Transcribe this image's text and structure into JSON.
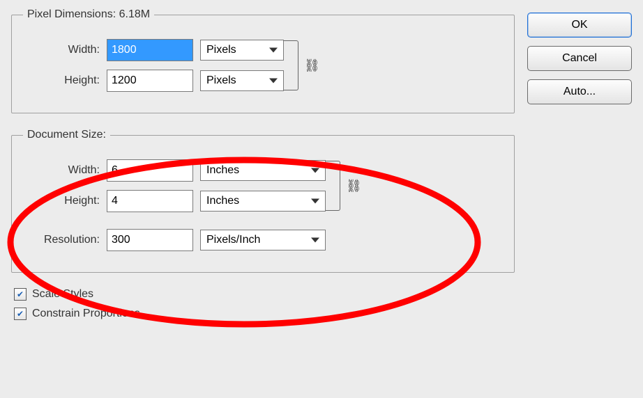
{
  "pixelDimensions": {
    "legend": "Pixel Dimensions:  6.18M",
    "widthLabel": "Width:",
    "widthValue": "1800",
    "widthUnit": "Pixels",
    "heightLabel": "Height:",
    "heightValue": "1200",
    "heightUnit": "Pixels"
  },
  "documentSize": {
    "legend": "Document Size:",
    "widthLabel": "Width:",
    "widthValue": "6",
    "widthUnit": "Inches",
    "heightLabel": "Height:",
    "heightValue": "4",
    "heightUnit": "Inches",
    "resolutionLabel": "Resolution:",
    "resolutionValue": "300",
    "resolutionUnit": "Pixels/Inch"
  },
  "checkboxes": {
    "scaleStyles": "Scale Styles",
    "constrainProportions": "Constrain Proportions"
  },
  "buttons": {
    "ok": "OK",
    "cancel": "Cancel",
    "auto": "Auto..."
  },
  "linkGlyph": "⛓"
}
